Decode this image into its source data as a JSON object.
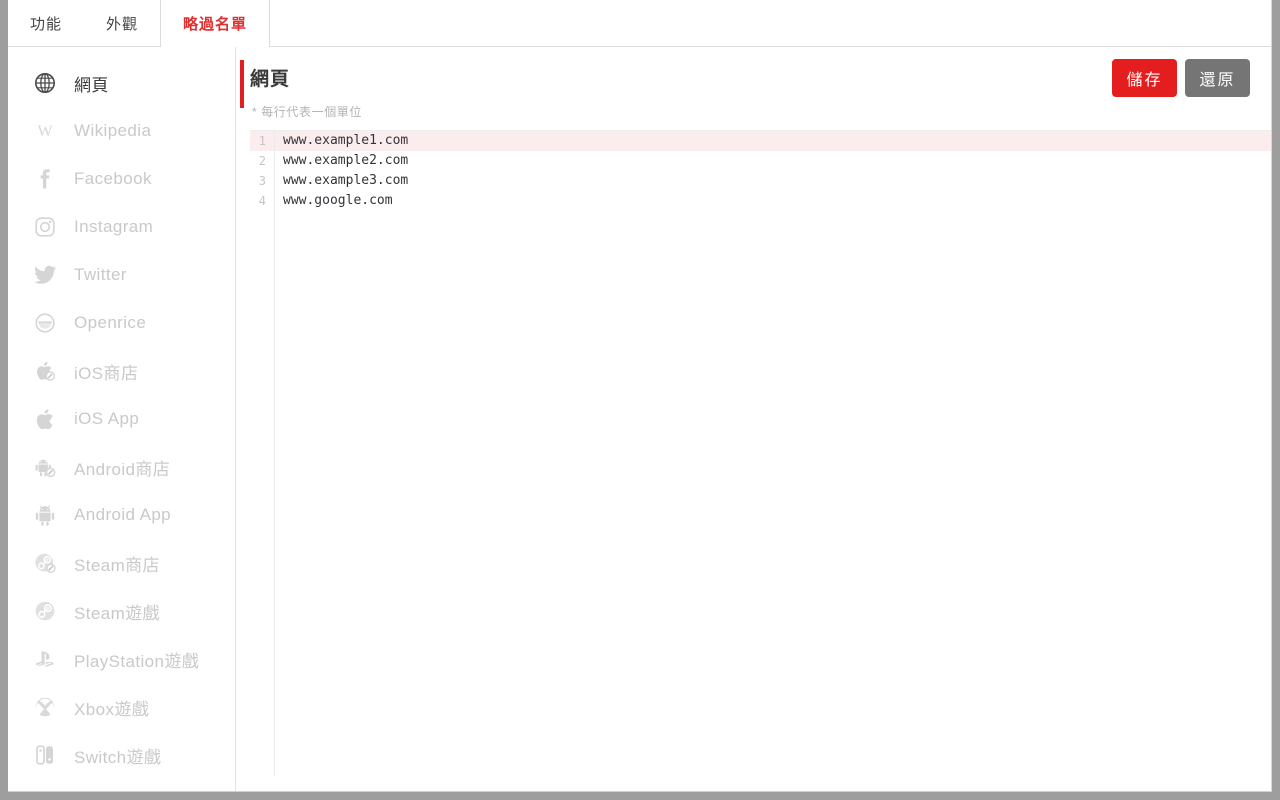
{
  "window": {
    "background_color": "#9e9e9e",
    "panel_color": "#ffffff"
  },
  "tabs": [
    {
      "label": "功能",
      "active": false
    },
    {
      "label": "外觀",
      "active": false
    },
    {
      "label": "略過名單",
      "active": true
    }
  ],
  "colors": {
    "accent_red": "#e41e1e",
    "active_tab_text": "#e03030",
    "restore_gray": "#757575",
    "active_line_highlight": "#fbeded",
    "muted_text": "#c9c9c9"
  },
  "sidebar": {
    "items": [
      {
        "label": "網頁",
        "icon": "globe-icon",
        "active": true
      },
      {
        "label": "Wikipedia",
        "icon": "wikipedia-icon",
        "active": false
      },
      {
        "label": "Facebook",
        "icon": "facebook-icon",
        "active": false
      },
      {
        "label": "Instagram",
        "icon": "instagram-icon",
        "active": false
      },
      {
        "label": "Twitter",
        "icon": "twitter-icon",
        "active": false
      },
      {
        "label": "Openrice",
        "icon": "openrice-icon",
        "active": false
      },
      {
        "label": "iOS商店",
        "icon": "ios-store-icon",
        "active": false
      },
      {
        "label": "iOS App",
        "icon": "apple-icon",
        "active": false
      },
      {
        "label": "Android商店",
        "icon": "android-store-icon",
        "active": false
      },
      {
        "label": "Android App",
        "icon": "android-icon",
        "active": false
      },
      {
        "label": "Steam商店",
        "icon": "steam-store-icon",
        "active": false
      },
      {
        "label": "Steam遊戲",
        "icon": "steam-icon",
        "active": false
      },
      {
        "label": "PlayStation遊戲",
        "icon": "playstation-icon",
        "active": false
      },
      {
        "label": "Xbox遊戲",
        "icon": "xbox-icon",
        "active": false
      },
      {
        "label": "Switch遊戲",
        "icon": "switch-icon",
        "active": false
      }
    ]
  },
  "main": {
    "title": "網頁",
    "hint": "* 每行代表一個單位",
    "save_label": "儲存",
    "restore_label": "還原"
  },
  "editor": {
    "lines": [
      {
        "num": "1",
        "text": "www.example1.com",
        "active": true
      },
      {
        "num": "2",
        "text": "www.example2.com",
        "active": false
      },
      {
        "num": "3",
        "text": "www.example3.com",
        "active": false
      },
      {
        "num": "4",
        "text": "www.google.com",
        "active": false
      }
    ]
  }
}
